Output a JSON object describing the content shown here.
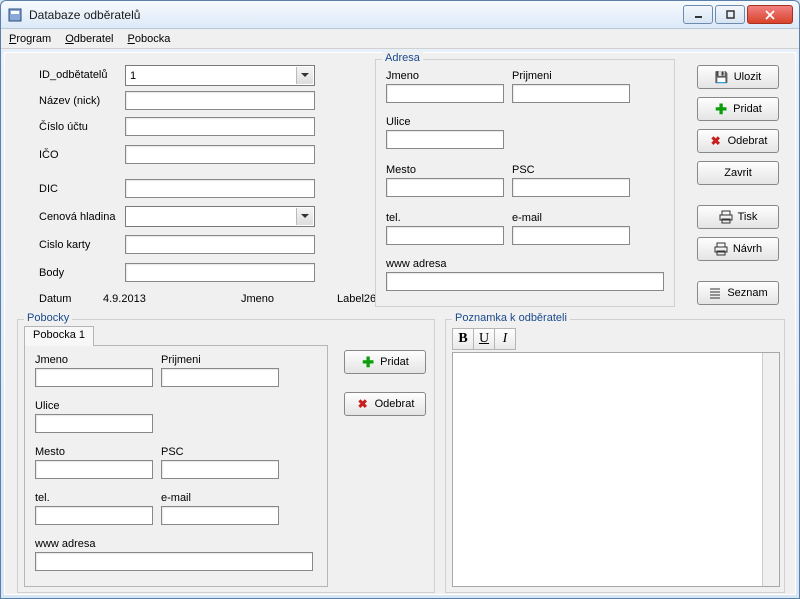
{
  "window": {
    "title": "Databaze odběratelů"
  },
  "menu": {
    "program": "Program",
    "odberatel": "Odberatel",
    "pobocka": "Pobocka"
  },
  "left": {
    "id_odberatelu_label": "ID_odbětatelů",
    "id_odberatelu_value": "1",
    "nazev_label": "Název (nick)",
    "nazev_value": "",
    "cislo_uctu_label": "Číslo účtu",
    "cislo_uctu_value": "",
    "ico_label": "IČO",
    "ico_value": "",
    "dic_label": "DIC",
    "dic_value": "",
    "cenova_hladina_label": "Cenová hladina",
    "cenova_hladina_value": "",
    "cislo_karty_label": "Cislo karty",
    "cislo_karty_value": "",
    "body_label": "Body",
    "body_value": "",
    "datum_label": "Datum",
    "datum_value": "4.9.2013",
    "jmeno_label": "Jmeno",
    "label26": "Label26"
  },
  "adresa": {
    "legend": "Adresa",
    "jmeno_label": "Jmeno",
    "jmeno_value": "",
    "prijmeni_label": "Prijmeni",
    "prijmeni_value": "",
    "ulice_label": "Ulice",
    "ulice_value": "",
    "mesto_label": "Mesto",
    "mesto_value": "",
    "psc_label": "PSC",
    "psc_value": "",
    "tel_label": "tel.",
    "tel_value": "",
    "email_label": "e-mail",
    "email_value": "",
    "www_label": "www adresa",
    "www_value": ""
  },
  "sidebar": {
    "ulozit": "Ulozit",
    "pridat": "Pridat",
    "odebrat": "Odebrat",
    "zavrit": "Zavrit",
    "tisk": "Tisk",
    "navrh": "Návrh",
    "seznam": "Seznam"
  },
  "pobocky": {
    "legend": "Pobocky",
    "tab1": "Pobocka 1",
    "jmeno_label": "Jmeno",
    "jmeno_value": "",
    "prijmeni_label": "Prijmeni",
    "prijmeni_value": "",
    "ulice_label": "Ulice",
    "ulice_value": "",
    "mesto_label": "Mesto",
    "mesto_value": "",
    "psc_label": "PSC",
    "psc_value": "",
    "tel_label": "tel.",
    "tel_value": "",
    "email_label": "e-mail",
    "email_value": "",
    "www_label": "www adresa",
    "www_value": "",
    "pridat": "Pridat",
    "odebrat": "Odebrat"
  },
  "poznamka": {
    "legend": "Poznamka k odběrateli",
    "bold": "B",
    "underline": "U",
    "italic": "I",
    "text": ""
  }
}
